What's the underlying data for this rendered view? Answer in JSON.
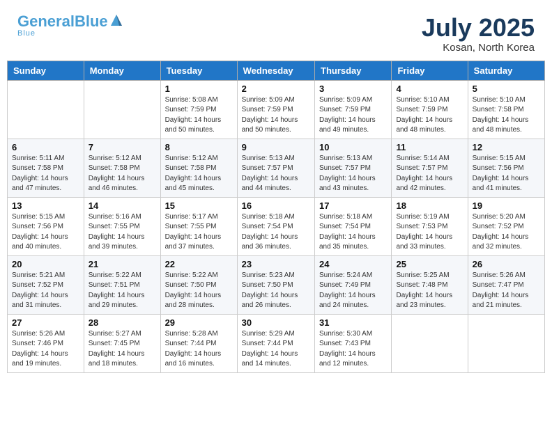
{
  "header": {
    "logo_line1a": "General",
    "logo_line1b": "Blue",
    "month_title": "July 2025",
    "location": "Kosan, North Korea"
  },
  "days_of_week": [
    "Sunday",
    "Monday",
    "Tuesday",
    "Wednesday",
    "Thursday",
    "Friday",
    "Saturday"
  ],
  "weeks": [
    [
      {
        "day": "",
        "info": ""
      },
      {
        "day": "",
        "info": ""
      },
      {
        "day": "1",
        "info": "Sunrise: 5:08 AM\nSunset: 7:59 PM\nDaylight: 14 hours\nand 50 minutes."
      },
      {
        "day": "2",
        "info": "Sunrise: 5:09 AM\nSunset: 7:59 PM\nDaylight: 14 hours\nand 50 minutes."
      },
      {
        "day": "3",
        "info": "Sunrise: 5:09 AM\nSunset: 7:59 PM\nDaylight: 14 hours\nand 49 minutes."
      },
      {
        "day": "4",
        "info": "Sunrise: 5:10 AM\nSunset: 7:59 PM\nDaylight: 14 hours\nand 48 minutes."
      },
      {
        "day": "5",
        "info": "Sunrise: 5:10 AM\nSunset: 7:58 PM\nDaylight: 14 hours\nand 48 minutes."
      }
    ],
    [
      {
        "day": "6",
        "info": "Sunrise: 5:11 AM\nSunset: 7:58 PM\nDaylight: 14 hours\nand 47 minutes."
      },
      {
        "day": "7",
        "info": "Sunrise: 5:12 AM\nSunset: 7:58 PM\nDaylight: 14 hours\nand 46 minutes."
      },
      {
        "day": "8",
        "info": "Sunrise: 5:12 AM\nSunset: 7:58 PM\nDaylight: 14 hours\nand 45 minutes."
      },
      {
        "day": "9",
        "info": "Sunrise: 5:13 AM\nSunset: 7:57 PM\nDaylight: 14 hours\nand 44 minutes."
      },
      {
        "day": "10",
        "info": "Sunrise: 5:13 AM\nSunset: 7:57 PM\nDaylight: 14 hours\nand 43 minutes."
      },
      {
        "day": "11",
        "info": "Sunrise: 5:14 AM\nSunset: 7:57 PM\nDaylight: 14 hours\nand 42 minutes."
      },
      {
        "day": "12",
        "info": "Sunrise: 5:15 AM\nSunset: 7:56 PM\nDaylight: 14 hours\nand 41 minutes."
      }
    ],
    [
      {
        "day": "13",
        "info": "Sunrise: 5:15 AM\nSunset: 7:56 PM\nDaylight: 14 hours\nand 40 minutes."
      },
      {
        "day": "14",
        "info": "Sunrise: 5:16 AM\nSunset: 7:55 PM\nDaylight: 14 hours\nand 39 minutes."
      },
      {
        "day": "15",
        "info": "Sunrise: 5:17 AM\nSunset: 7:55 PM\nDaylight: 14 hours\nand 37 minutes."
      },
      {
        "day": "16",
        "info": "Sunrise: 5:18 AM\nSunset: 7:54 PM\nDaylight: 14 hours\nand 36 minutes."
      },
      {
        "day": "17",
        "info": "Sunrise: 5:18 AM\nSunset: 7:54 PM\nDaylight: 14 hours\nand 35 minutes."
      },
      {
        "day": "18",
        "info": "Sunrise: 5:19 AM\nSunset: 7:53 PM\nDaylight: 14 hours\nand 33 minutes."
      },
      {
        "day": "19",
        "info": "Sunrise: 5:20 AM\nSunset: 7:52 PM\nDaylight: 14 hours\nand 32 minutes."
      }
    ],
    [
      {
        "day": "20",
        "info": "Sunrise: 5:21 AM\nSunset: 7:52 PM\nDaylight: 14 hours\nand 31 minutes."
      },
      {
        "day": "21",
        "info": "Sunrise: 5:22 AM\nSunset: 7:51 PM\nDaylight: 14 hours\nand 29 minutes."
      },
      {
        "day": "22",
        "info": "Sunrise: 5:22 AM\nSunset: 7:50 PM\nDaylight: 14 hours\nand 28 minutes."
      },
      {
        "day": "23",
        "info": "Sunrise: 5:23 AM\nSunset: 7:50 PM\nDaylight: 14 hours\nand 26 minutes."
      },
      {
        "day": "24",
        "info": "Sunrise: 5:24 AM\nSunset: 7:49 PM\nDaylight: 14 hours\nand 24 minutes."
      },
      {
        "day": "25",
        "info": "Sunrise: 5:25 AM\nSunset: 7:48 PM\nDaylight: 14 hours\nand 23 minutes."
      },
      {
        "day": "26",
        "info": "Sunrise: 5:26 AM\nSunset: 7:47 PM\nDaylight: 14 hours\nand 21 minutes."
      }
    ],
    [
      {
        "day": "27",
        "info": "Sunrise: 5:26 AM\nSunset: 7:46 PM\nDaylight: 14 hours\nand 19 minutes."
      },
      {
        "day": "28",
        "info": "Sunrise: 5:27 AM\nSunset: 7:45 PM\nDaylight: 14 hours\nand 18 minutes."
      },
      {
        "day": "29",
        "info": "Sunrise: 5:28 AM\nSunset: 7:44 PM\nDaylight: 14 hours\nand 16 minutes."
      },
      {
        "day": "30",
        "info": "Sunrise: 5:29 AM\nSunset: 7:44 PM\nDaylight: 14 hours\nand 14 minutes."
      },
      {
        "day": "31",
        "info": "Sunrise: 5:30 AM\nSunset: 7:43 PM\nDaylight: 14 hours\nand 12 minutes."
      },
      {
        "day": "",
        "info": ""
      },
      {
        "day": "",
        "info": ""
      }
    ]
  ]
}
